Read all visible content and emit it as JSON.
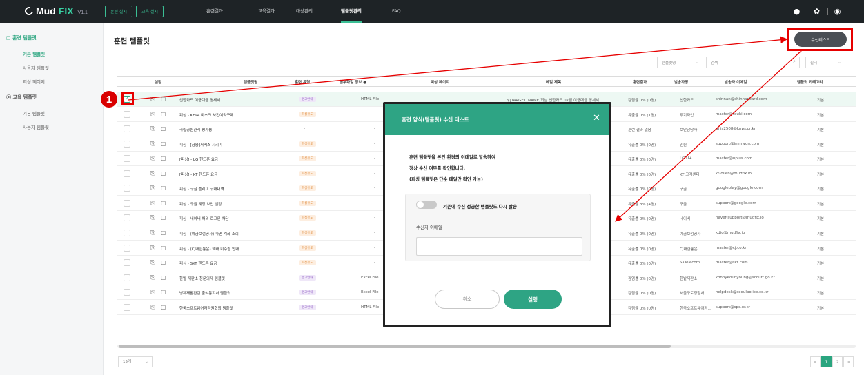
{
  "header": {
    "logo_text": "Mud",
    "logo_accent": "FIX",
    "version": "V1.1",
    "btn_training": "훈련 실시",
    "btn_education": "교육 실시",
    "nav": [
      "훈련결과",
      "교육결과",
      "대상관리",
      "템플릿관리",
      "FAQ"
    ],
    "active_nav": "템플릿관리",
    "icons": [
      "info-icon",
      "gear-icon",
      "user-icon"
    ]
  },
  "sidebar": {
    "group1": "훈련 템플릿",
    "group1_items": [
      "기본 템플릿",
      "사용자 템플릿",
      "피싱 페이지"
    ],
    "group2": "교육 템플릿",
    "group2_items": [
      "기본 템플릿",
      "사용자 템플릿"
    ]
  },
  "page": {
    "title": "훈련 템플릿",
    "test_button": "수신테스트",
    "filter_select": "템플릿명",
    "search_placeholder": "검색",
    "filter_button": "필터"
  },
  "table": {
    "headers": [
      "설정",
      "템플릿명",
      "훈련 유형",
      "첨부파일 정보",
      "피싱 페이지",
      "메일 제목",
      "훈련결과",
      "발송자명",
      "발송자 이메일",
      "템플릿 카테고리"
    ],
    "rows": [
      {
        "name": "신한카드 이용대금 명세서",
        "type": "경고안내",
        "type_color": "purple",
        "attach": "HTML File",
        "phish": "-",
        "subject": "$[TARGET_NAME]회님 신한카드 07월 이용대금 명세서",
        "result": "감염률 0% (0명)",
        "sender": "신한카드",
        "email": "shinnan@shinhancard.com",
        "category": "기본",
        "checked": true
      },
      {
        "name": "피싱 - KF94 마스크 사전예약구매",
        "type": "피싱유도",
        "type_color": "orange",
        "attach": "-",
        "phish": "",
        "subject": "",
        "result": "유출률 0% (1명)",
        "sender": "투기자업",
        "email": "master@teuki.com",
        "category": "기본",
        "checked": false
      },
      {
        "name": "국립공원관리 평가용",
        "type": "",
        "type_color": "",
        "attach": "-",
        "phish": "",
        "subject": "",
        "result": "훈련 결과 없음",
        "sender": "보안담당자",
        "email": "bnjs2508@knps.or.kr",
        "category": "기본",
        "checked": false
      },
      {
        "name": "피싱 - [금융]서비스 지키미",
        "type": "피싱유도",
        "type_color": "orange",
        "attach": "-",
        "phish": "",
        "subject": "",
        "result": "유출률 0% (0명)",
        "sender": "인원",
        "email": "support@inimwon.com",
        "category": "기본",
        "checked": false
      },
      {
        "name": "[피싱] - LG 핸드폰 요금",
        "type": "피싱유도",
        "type_color": "orange",
        "attach": "-",
        "phish": "",
        "subject": "",
        "result": "유출률 0% (0명)",
        "sender": "LG U+",
        "email": "master@uplus.com",
        "category": "기본",
        "checked": false
      },
      {
        "name": "[피싱] - KT 핸드폰 요금",
        "type": "피싱유도",
        "type_color": "orange",
        "attach": "-",
        "phish": "",
        "subject": "",
        "result": "유출률 0% (0명)",
        "sender": "KT 고객센터",
        "email": "kt-olleh@mudfix.io",
        "category": "기본",
        "checked": false
      },
      {
        "name": "피싱 - 구글 플레이 구매내역",
        "type": "피싱유도",
        "type_color": "orange",
        "attach": "-",
        "phish": "",
        "subject": "",
        "result": "유출률 0% (0명)",
        "sender": "구글",
        "email": "googleplay@google.com",
        "category": "기본",
        "checked": false
      },
      {
        "name": "피싱 - 구글 계정 보안 설정",
        "type": "피싱유도",
        "type_color": "orange",
        "attach": "-",
        "phish": "",
        "subject": "",
        "result": "유출률 3% (4명)",
        "sender": "구글",
        "email": "support@google.com",
        "category": "기본",
        "checked": false
      },
      {
        "name": "피싱 - 네이버 해외 로그인 차단",
        "type": "피싱유도",
        "type_color": "orange",
        "attach": "-",
        "phish": "",
        "subject": "",
        "result": "유출률 0% (0명)",
        "sender": "네이버",
        "email": "naver-support@mudfix.io",
        "category": "기본",
        "checked": false
      },
      {
        "name": "피싱 - (예금보험공사) 파면 계좌 조회",
        "type": "피싱유도",
        "type_color": "orange",
        "attach": "-",
        "phish": "",
        "subject": "",
        "result": "유출률 0% (0명)",
        "sender": "예금보험공사",
        "email": "kdic@mudfix.io",
        "category": "기본",
        "checked": false
      },
      {
        "name": "피싱 - (CJ대한통운) 택배 미수령 안내",
        "type": "피싱유도",
        "type_color": "orange",
        "attach": "-",
        "phish": "",
        "subject": "",
        "result": "유출률 0% (0명)",
        "sender": "CJ대한통운",
        "email": "master@cj.co.kr",
        "category": "기본",
        "checked": false
      },
      {
        "name": "피싱 - SKT 핸드폰 요금",
        "type": "피싱유도",
        "type_color": "orange",
        "attach": "-",
        "phish": "",
        "subject": "",
        "result": "유출률 0% (0명)",
        "sender": "SKTelecom",
        "email": "master@skt.com",
        "category": "기본",
        "checked": false
      },
      {
        "name": "한밭 재판소 청문의제 템플릿",
        "type": "경고안내",
        "type_color": "purple",
        "attach": "Excel File",
        "phish": "",
        "subject": "",
        "result": "감염률 0% (0명)",
        "sender": "한밭재판소",
        "email": "kohhyeounyoung@scourt.go.kr",
        "category": "기본",
        "checked": false
      },
      {
        "name": "병제재활관련 출석통지서 템플릿",
        "type": "경고안내",
        "type_color": "purple",
        "attach": "Excel File",
        "phish": "",
        "subject": "",
        "result": "감염률 0% (0명)",
        "sender": "서울구로경찰서",
        "email": "helpdesk@seoulpolice.co.kr",
        "category": "기본",
        "checked": false
      },
      {
        "name": "한국소프트웨어저작권협회 템플릿",
        "type": "경고안내",
        "type_color": "purple",
        "attach": "HTML File",
        "phish": "",
        "subject": "",
        "result": "감염률 0% (0명)",
        "sender": "한국소프트웨어저...",
        "email": "support@spc.or.kr",
        "category": "기본",
        "checked": false
      }
    ]
  },
  "pagination": {
    "page_size": "15개",
    "pages": [
      "1",
      "2"
    ],
    "prev": "<",
    "next": ">"
  },
  "modal": {
    "title": "훈련 양식(템플릿) 수신 테스트",
    "close": "✕",
    "desc_lines": [
      "훈련 템플릿을 본인 환경의 이메일로 발송하여",
      "정상 수신 여부를 확인합니다.",
      "(피싱 템플릿은 단순 메일만 확인 가능)"
    ],
    "toggle_label": "기존에 수신 성공한 템플릿도 다시 발송",
    "toggle_on": false,
    "recipient_label": "수신자 이메일",
    "recipient_value": "",
    "cancel": "취소",
    "run": "실행"
  },
  "annotation": {
    "number": "1"
  },
  "colors": {
    "accent": "#2ea484",
    "header_bg": "#1e2326",
    "annotation_red": "#e60000"
  }
}
